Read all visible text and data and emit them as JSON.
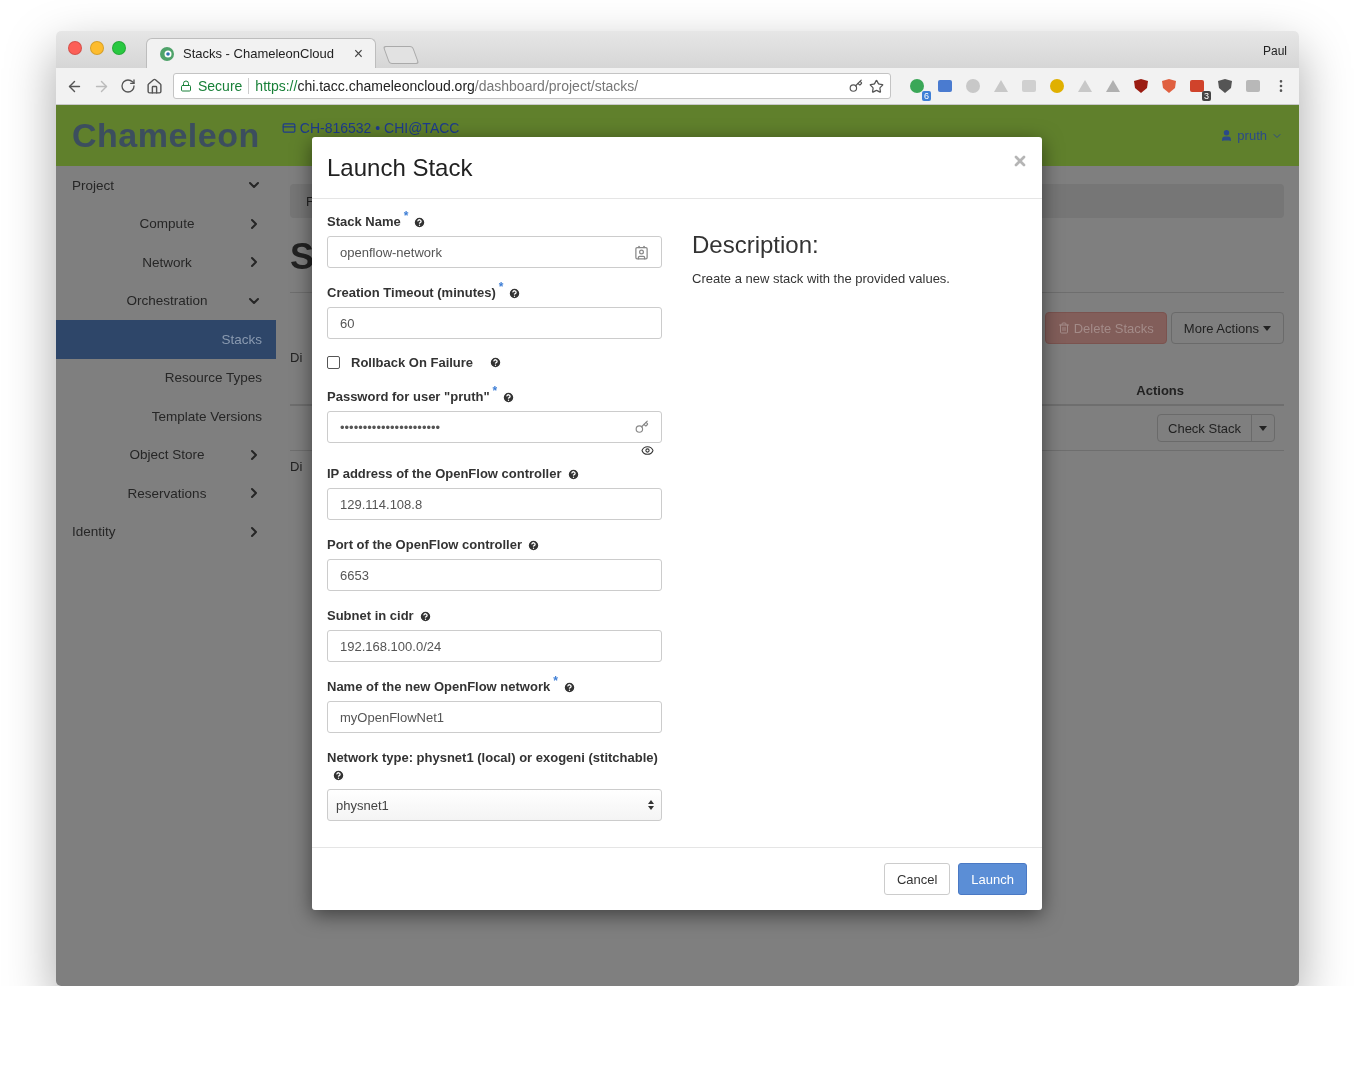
{
  "browser": {
    "tab": {
      "title": "Stacks - ChameleonCloud",
      "close": "×"
    },
    "profile": "Paul",
    "security": "Secure",
    "url": {
      "scheme": "https://",
      "host": "chi.tacc.chameleoncloud.org",
      "path": "/dashboard/project/stacks/"
    },
    "extensions": [
      {
        "kind": "dot",
        "color": "#3aa757",
        "badge": "6"
      },
      {
        "kind": "square",
        "color": "#4a7bd0"
      },
      {
        "kind": "dot",
        "color": "#c8c8c8"
      },
      {
        "kind": "triangle",
        "color": "#c8c8c8"
      },
      {
        "kind": "square",
        "color": "#d0d0d0"
      },
      {
        "kind": "dot",
        "color": "#e0b000"
      },
      {
        "kind": "triangle",
        "color": "#c8c8c8"
      },
      {
        "kind": "triangle",
        "color": "#b0b0b0"
      },
      {
        "kind": "shield",
        "color": "#9b1c12"
      },
      {
        "kind": "shield",
        "color": "#e06040"
      },
      {
        "kind": "square",
        "color": "#d0432b",
        "badge": "3"
      },
      {
        "kind": "shield",
        "color": "#555555"
      },
      {
        "kind": "square",
        "color": "#b8b8b8"
      }
    ]
  },
  "header": {
    "logo": "Chameleon",
    "project": "CH-816532 • CHI@TACC",
    "user": "pruth"
  },
  "sidebar": {
    "items": [
      {
        "label": "Project",
        "expanded": true,
        "selected": false,
        "children": [
          {
            "label": "Compute",
            "expanded": false,
            "selected": false
          },
          {
            "label": "Network",
            "expanded": false,
            "selected": false
          },
          {
            "label": "Orchestration",
            "expanded": true,
            "selected": false,
            "children": [
              {
                "label": "Stacks",
                "selected": true
              },
              {
                "label": "Resource Types",
                "selected": false
              },
              {
                "label": "Template Versions",
                "selected": false
              }
            ]
          },
          {
            "label": "Object Store",
            "expanded": false,
            "selected": false
          },
          {
            "label": "Reservations",
            "expanded": false,
            "selected": false
          }
        ]
      },
      {
        "label": "Identity",
        "expanded": false,
        "selected": false
      }
    ]
  },
  "page": {
    "breadcrumb": "F",
    "title": "S",
    "filter_text": "Di",
    "footer_text": "Di",
    "buttons": [
      {
        "label": "Delete Stacks",
        "disabled": true,
        "kind": "danger"
      },
      {
        "label": "More Actions",
        "disabled": false,
        "kind": "dropdown"
      }
    ],
    "table": {
      "columns": [
        "Actions"
      ],
      "rows": [
        {
          "action": "Check Stack"
        }
      ]
    }
  },
  "modal": {
    "title": "Launch Stack",
    "required_mark": "*",
    "fields": [
      {
        "kind": "text",
        "label": "Stack Name",
        "required": true,
        "value": "openflow-network",
        "autofill": true
      },
      {
        "kind": "text",
        "label": "Creation Timeout (minutes)",
        "required": true,
        "value": "60"
      },
      {
        "kind": "checkbox",
        "label": "Rollback On Failure",
        "checked": false
      },
      {
        "kind": "password",
        "label": "Password for user \"pruth\"",
        "required": true,
        "value": "••••••••••••••••••••••"
      },
      {
        "kind": "text",
        "label": "IP address of the OpenFlow controller",
        "required": false,
        "value": "129.114.108.8"
      },
      {
        "kind": "text",
        "label": "Port of the OpenFlow controller",
        "required": false,
        "value": "6653"
      },
      {
        "kind": "text",
        "label": "Subnet in cidr",
        "required": false,
        "value": "192.168.100.0/24"
      },
      {
        "kind": "text",
        "label": "Name of the new OpenFlow network",
        "required": true,
        "value": "myOpenFlowNet1"
      },
      {
        "kind": "select",
        "label": "Network type: physnet1 (local) or exogeni (stitchable)",
        "required": false,
        "value": "physnet1"
      }
    ],
    "description": {
      "heading": "Description:",
      "text": "Create a new stack with the provided values."
    },
    "buttons": [
      {
        "label": "Cancel",
        "kind": "default"
      },
      {
        "label": "Launch",
        "kind": "primary"
      }
    ]
  }
}
